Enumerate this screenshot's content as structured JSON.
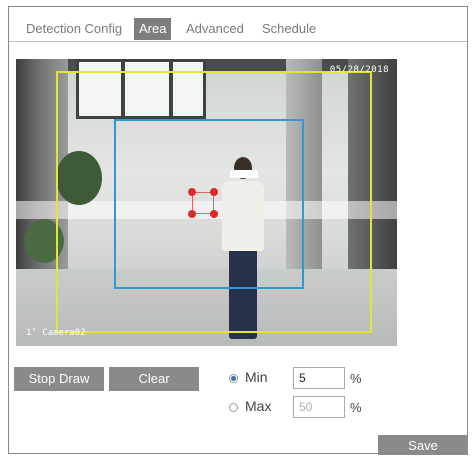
{
  "tabs": [
    {
      "label": "Detection Config",
      "active": false
    },
    {
      "label": "Area",
      "active": true
    },
    {
      "label": "Advanced",
      "active": false
    },
    {
      "label": "Schedule",
      "active": false
    }
  ],
  "video": {
    "timestamp": "05/28/2018",
    "camera_name": "Camera02"
  },
  "area_colors": {
    "outer": "#e7e23a",
    "inner": "#2f9ad2",
    "handles": "#e02a2a"
  },
  "buttons": {
    "stop_draw": "Stop Draw",
    "clear": "Clear",
    "save": "Save"
  },
  "size_filter": {
    "options": [
      {
        "label": "Min",
        "selected": true,
        "value": "5",
        "placeholder": ""
      },
      {
        "label": "Max",
        "selected": false,
        "value": "",
        "placeholder": "50"
      }
    ],
    "unit": "%"
  }
}
